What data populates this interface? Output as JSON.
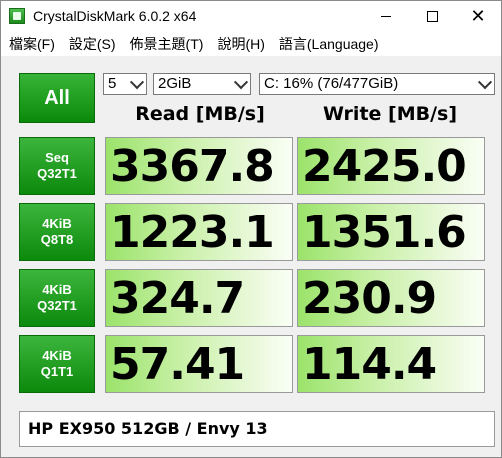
{
  "window": {
    "title": "CrystalDiskMark 6.0.2 x64"
  },
  "menu": [
    "檔案(F)",
    "設定(S)",
    "佈景主題(T)",
    "說明(H)",
    "語言(Language)"
  ],
  "controls": {
    "all_label": "All",
    "count": "5",
    "size": "2GiB",
    "drive": "C: 16% (76/477GiB)"
  },
  "headers": {
    "read": "Read [MB/s]",
    "write": "Write [MB/s]"
  },
  "rows": [
    {
      "line1": "Seq",
      "line2": "Q32T1",
      "read": "3367.8",
      "write": "2425.0"
    },
    {
      "line1": "4KiB",
      "line2": "Q8T8",
      "read": "1223.1",
      "write": "1351.6"
    },
    {
      "line1": "4KiB",
      "line2": "Q32T1",
      "read": "324.7",
      "write": "230.9"
    },
    {
      "line1": "4KiB",
      "line2": "Q1T1",
      "read": "57.41",
      "write": "114.4"
    }
  ],
  "comment": "HP EX950 512GB / Envy 13"
}
